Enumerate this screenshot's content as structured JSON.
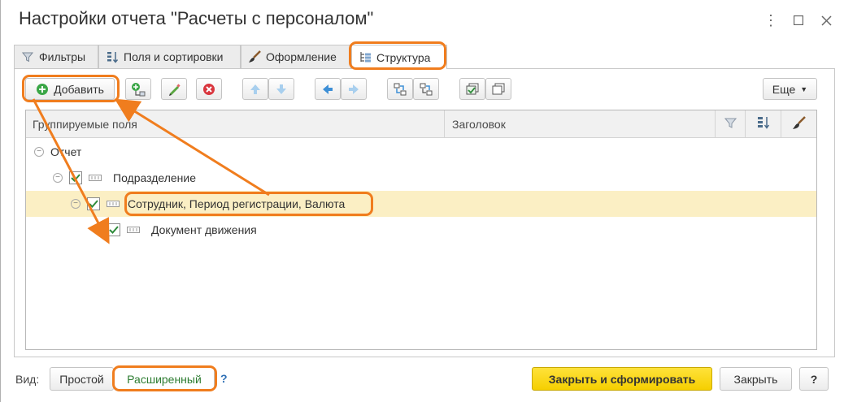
{
  "window": {
    "title": "Настройки отчета \"Расчеты с персоналом\""
  },
  "tabs": [
    {
      "label": "Фильтры",
      "icon": "filter-icon"
    },
    {
      "label": "Поля и сортировки",
      "icon": "sort-icon"
    },
    {
      "label": "Оформление",
      "icon": "brush-icon"
    },
    {
      "label": "Структура",
      "icon": "structure-icon",
      "active": true
    }
  ],
  "toolbar": {
    "add_label": "Добавить",
    "more_label": "Еще"
  },
  "grid": {
    "columns": [
      "Группируемые поля",
      "Заголовок"
    ],
    "header_icons": [
      "filter-icon",
      "sort-icon",
      "brush-icon"
    ],
    "rows": [
      {
        "label": "Отчет",
        "checked": false
      },
      {
        "label": "Подразделение",
        "checked": true
      },
      {
        "label": "Сотрудник, Период регистрации, Валюта",
        "checked": true,
        "selected": true
      },
      {
        "label": "Документ движения",
        "checked": true
      }
    ]
  },
  "footer": {
    "view_label": "Вид:",
    "simple_label": "Простой",
    "extended_label": "Расширенный",
    "help_label": "?",
    "close_generate_label": "Закрыть и сформировать",
    "close_label": "Закрыть",
    "question_label": "?"
  },
  "colors": {
    "accent": "#f07d1e",
    "selected_row": "#fbefc4",
    "primary_button": "#f5cf00",
    "checkmark": "#2e8b3a"
  }
}
